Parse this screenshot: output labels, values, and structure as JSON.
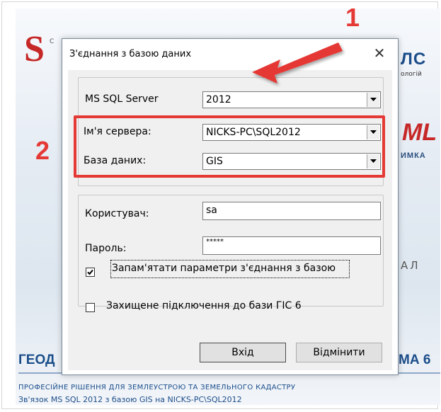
{
  "splash": {
    "logo_letter": "S",
    "logo_small": "С",
    "right_top": "ЛС",
    "right_small": "ологій",
    "right_ml": "ML",
    "right_mka": "ИМКА",
    "right_al": "АЛ",
    "geo_left": "ГЕОД",
    "geo_right": "МА 6",
    "tagline": "ПРОФЕСІЙНЕ РІШЕННЯ ДЛЯ ЗЕМЛЕУСТРОЮ ТА ЗЕМЕЛЬНОГО КАДАСТРУ",
    "status": "Зв'язок MS SQL 2012 з базою GIS на NICKS-PC\\SQL2012"
  },
  "annotations": {
    "step1": "1",
    "step2": "2"
  },
  "colors": {
    "annotation_red": "#e53935",
    "brand_blue": "#1b4d8a"
  },
  "dialog": {
    "title": "З'єднання з базою даних",
    "close_glyph": "✕",
    "server_group": {
      "version_label": "MS SQL Server",
      "version_value": "2012",
      "server_label": "Ім'я сервера:",
      "server_value": "NICKS-PC\\SQL2012",
      "database_label": "База даних:",
      "database_value": "GIS"
    },
    "login_group": {
      "user_label": "Користувач:",
      "user_value": "sa",
      "password_label": "Пароль:",
      "password_value": "*****",
      "remember_label": "Запам'ятати параметри з'єднання з базою",
      "remember_checked": true,
      "secure_label": "Захищене підключення до бази ГІС 6",
      "secure_checked": false
    },
    "ok_label": "Вхід",
    "cancel_label": "Відмінити"
  }
}
